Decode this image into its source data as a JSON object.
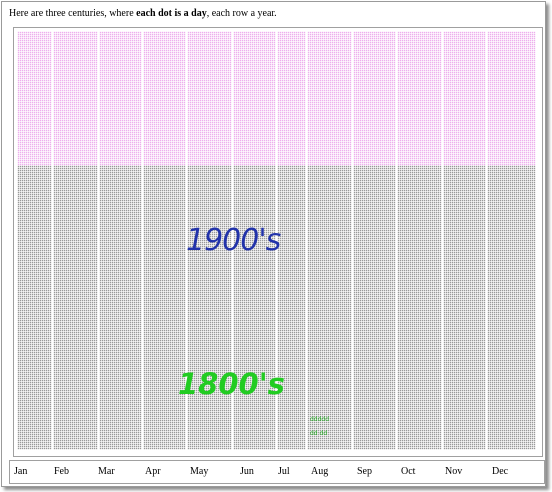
{
  "intro": {
    "prefix": "Here are three centuries, where ",
    "emphasis": "each dot is a day",
    "suffix": ", each row a year."
  },
  "labels": {
    "era_1900": "1900's",
    "era_1800": "1800's",
    "note_1": "ddddd",
    "note_2": "dd dd"
  },
  "colors": {
    "future": "#e070e0",
    "past": "#4a4a4a",
    "label_1900": "#2233aa",
    "label_1800": "#22cc22"
  },
  "months": [
    "Jan",
    "Feb",
    "Mar",
    "Apr",
    "May",
    "Jun",
    "Jul",
    "Aug",
    "Sep",
    "Oct",
    "Nov",
    "Dec"
  ]
}
